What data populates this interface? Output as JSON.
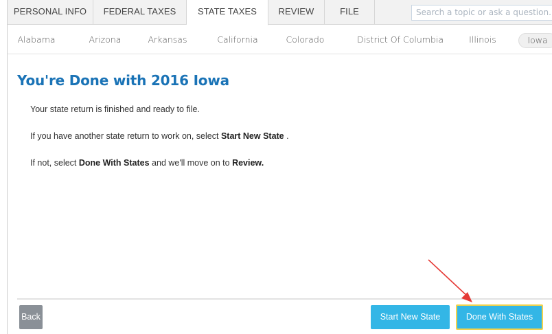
{
  "top_tabs": [
    {
      "label": "PERSONAL INFO"
    },
    {
      "label": "FEDERAL TAXES"
    },
    {
      "label": "STATE TAXES"
    },
    {
      "label": "REVIEW"
    },
    {
      "label": "FILE"
    }
  ],
  "active_top_tab": "STATE TAXES",
  "search": {
    "placeholder": "Search a topic or ask a question."
  },
  "state_tabs": [
    {
      "label": "Alabama"
    },
    {
      "label": "Arizona"
    },
    {
      "label": "Arkansas"
    },
    {
      "label": "California"
    },
    {
      "label": "Colorado"
    },
    {
      "label": "District Of Columbia"
    },
    {
      "label": "Illinois"
    },
    {
      "label": "Iowa"
    }
  ],
  "active_state_tab": "Iowa",
  "main": {
    "title": "You're Done with 2016 Iowa",
    "line1": "Your state return is finished and ready to file.",
    "line2_pre": "If you have another state return to work on, select ",
    "line2_bold": "Start New State",
    "line2_post": " .",
    "line3_pre": "If not, select ",
    "line3_bold1": "Done With States",
    "line3_mid": " and we'll move on to ",
    "line3_bold2": "Review."
  },
  "buttons": {
    "back": "Back",
    "start_new_state": "Start New State",
    "done_with_states": "Done With States"
  },
  "colors": {
    "accent_blue": "#33b6e6",
    "title_blue": "#1a73b6",
    "highlight_border": "#f1d24b",
    "annotation_arrow": "#e53935"
  }
}
